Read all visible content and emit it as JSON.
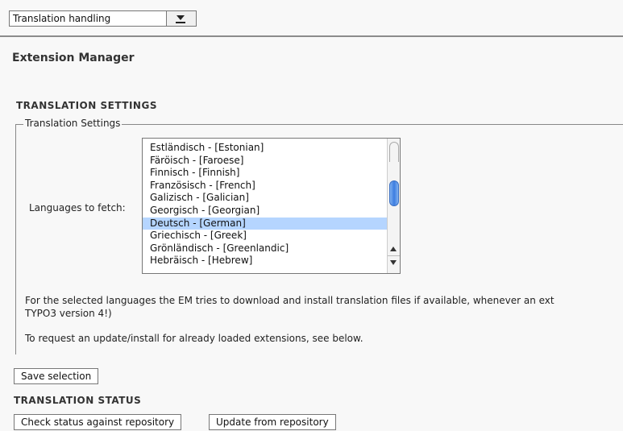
{
  "top_menu": {
    "selected": "Translation handling"
  },
  "page_title": "Extension Manager",
  "settings_heading": "TRANSLATION SETTINGS",
  "settings_legend": "Translation Settings",
  "languages_label": "Languages to fetch:",
  "languages": [
    {
      "label": "Estländisch - [Estonian]",
      "selected": false
    },
    {
      "label": "Färöisch - [Faroese]",
      "selected": false
    },
    {
      "label": "Finnisch - [Finnish]",
      "selected": false
    },
    {
      "label": "Französisch - [French]",
      "selected": false
    },
    {
      "label": "Galizisch - [Galician]",
      "selected": false
    },
    {
      "label": "Georgisch - [Georgian]",
      "selected": false
    },
    {
      "label": "Deutsch - [German]",
      "selected": true
    },
    {
      "label": "Griechisch - [Greek]",
      "selected": false
    },
    {
      "label": "Grönländisch - [Greenlandic]",
      "selected": false
    },
    {
      "label": "Hebräisch - [Hebrew]",
      "selected": false
    }
  ],
  "description_line1": "For the selected languages the EM tries to download and install translation files if available, whenever an ext",
  "description_line2": "TYPO3 version 4!)",
  "description_line3": "To request an update/install for already loaded extensions, see below.",
  "save_button": "Save selection",
  "status_heading": "TRANSLATION STATUS",
  "check_button": "Check status against repository",
  "update_button": "Update from repository"
}
